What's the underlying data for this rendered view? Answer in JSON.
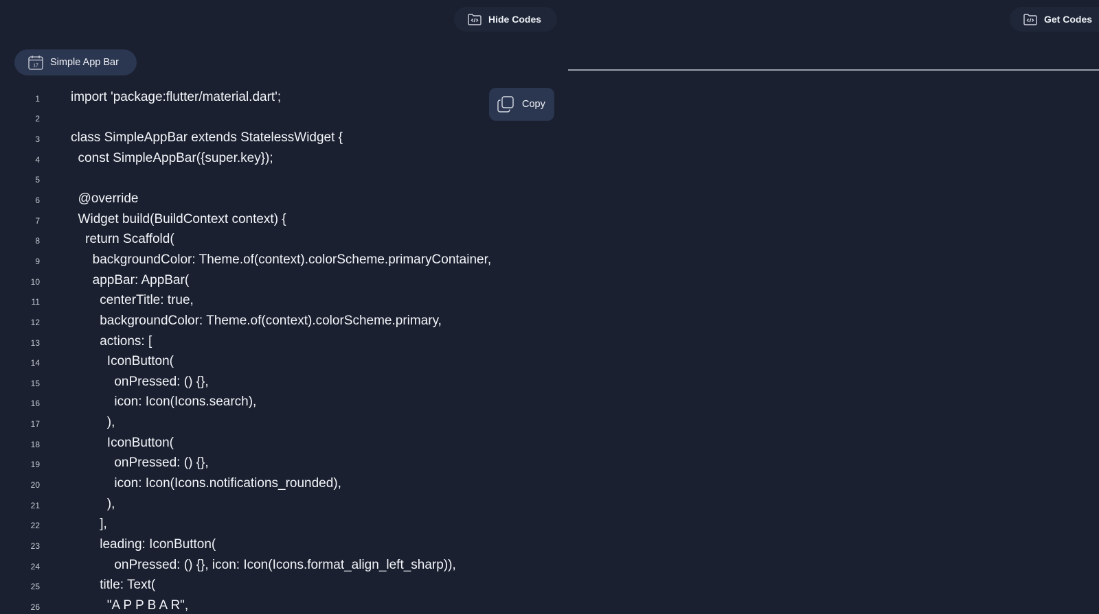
{
  "toolbar": {
    "hide_codes_label": "Hide Codes",
    "get_codes_label": "Get Codes"
  },
  "tab": {
    "label": "Simple App Bar"
  },
  "copy_label": "Copy",
  "code_lines": [
    {
      "no": "1",
      "text": "import 'package:flutter/material.dart';"
    },
    {
      "no": "2",
      "text": ""
    },
    {
      "no": "3",
      "text": "class SimpleAppBar extends StatelessWidget {"
    },
    {
      "no": "4",
      "text": "  const SimpleAppBar({super.key});"
    },
    {
      "no": "5",
      "text": ""
    },
    {
      "no": "6",
      "text": "  @override"
    },
    {
      "no": "7",
      "text": "  Widget build(BuildContext context) {"
    },
    {
      "no": "8",
      "text": "    return Scaffold("
    },
    {
      "no": "9",
      "text": "      backgroundColor: Theme.of(context).colorScheme.primaryContainer,"
    },
    {
      "no": "10",
      "text": "      appBar: AppBar("
    },
    {
      "no": "11",
      "text": "        centerTitle: true,"
    },
    {
      "no": "12",
      "text": "        backgroundColor: Theme.of(context).colorScheme.primary,"
    },
    {
      "no": "13",
      "text": "        actions: ["
    },
    {
      "no": "14",
      "text": "          IconButton("
    },
    {
      "no": "15",
      "text": "            onPressed: () {},"
    },
    {
      "no": "16",
      "text": "            icon: Icon(Icons.search),"
    },
    {
      "no": "17",
      "text": "          ),"
    },
    {
      "no": "18",
      "text": "          IconButton("
    },
    {
      "no": "19",
      "text": "            onPressed: () {},"
    },
    {
      "no": "20",
      "text": "            icon: Icon(Icons.notifications_rounded),"
    },
    {
      "no": "21",
      "text": "          ),"
    },
    {
      "no": "22",
      "text": "        ],"
    },
    {
      "no": "23",
      "text": "        leading: IconButton("
    },
    {
      "no": "24",
      "text": "            onPressed: () {}, icon: Icon(Icons.format_align_left_sharp)),"
    },
    {
      "no": "25",
      "text": "        title: Text("
    },
    {
      "no": "26",
      "text": "          \"A P P B A R\","
    }
  ]
}
